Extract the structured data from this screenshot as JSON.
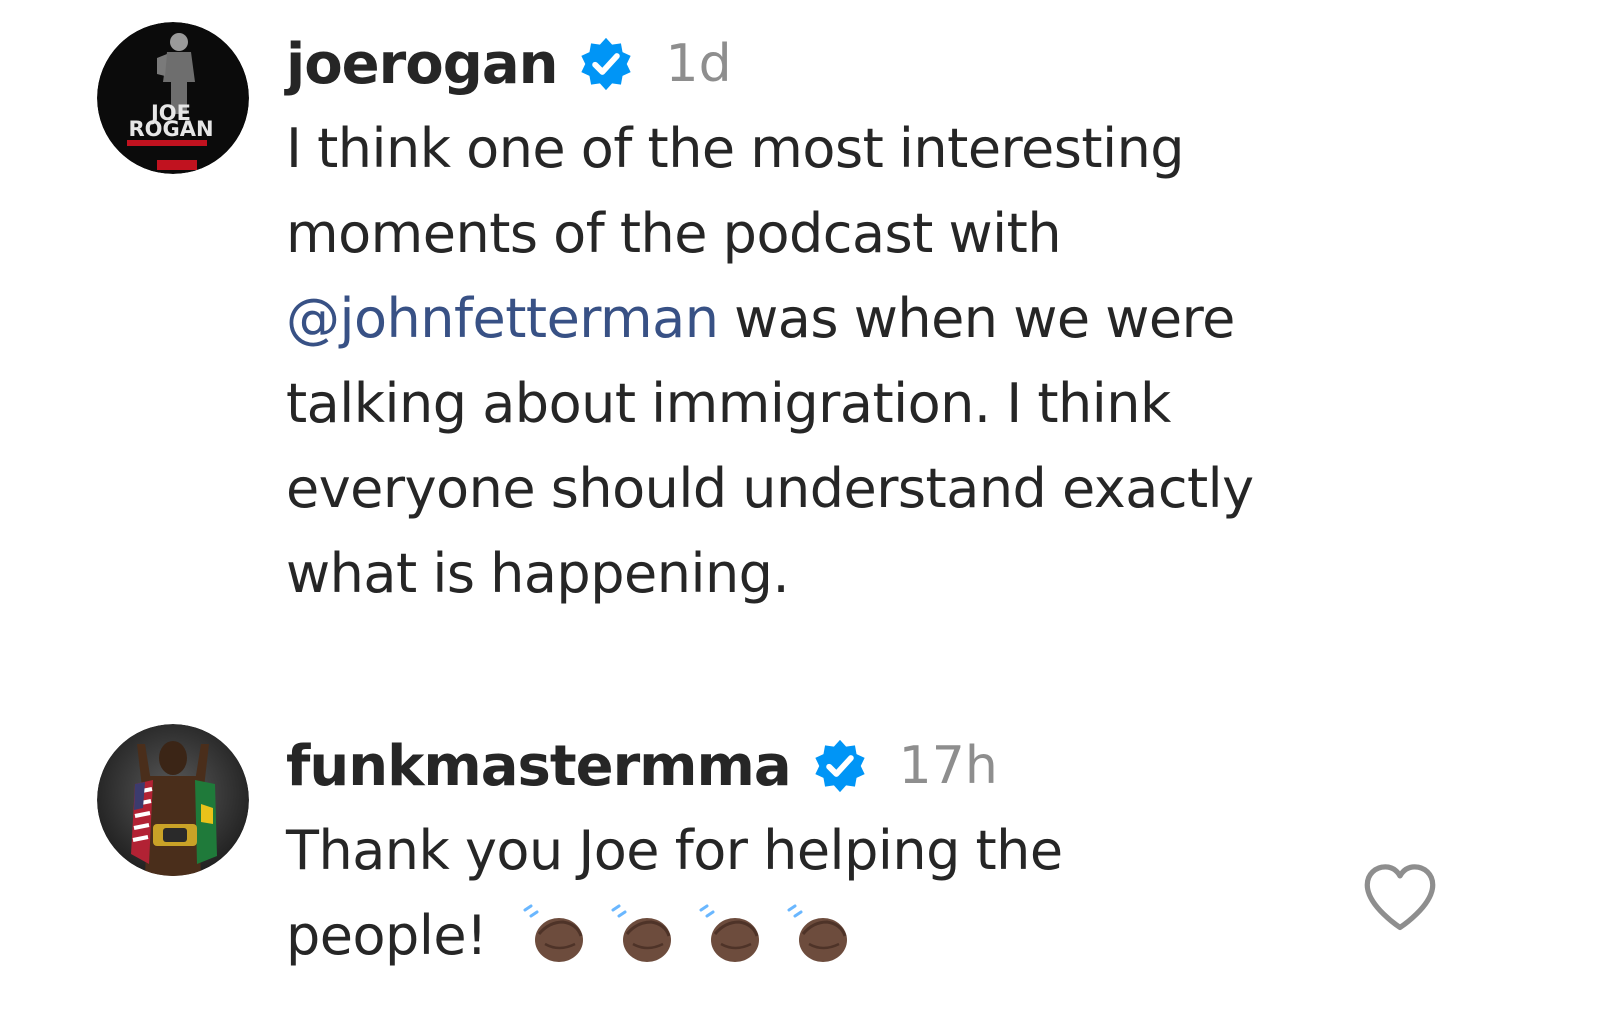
{
  "comments": [
    {
      "username": "joerogan",
      "time": "1d",
      "avatar_text_line1": "JOE",
      "avatar_text_line2": "ROGAN",
      "text_before": "I think one of the most interesting moments of the podcast with ",
      "mention": "@johnfetterman",
      "text_after": " was when we were talking about immigration. I think everyone should understand exactly what is happening."
    },
    {
      "username": "funkmastermma",
      "time": "17h",
      "text": "Thank you Joe for helping the people!",
      "emoji_count": 4
    }
  ],
  "icons": {
    "verified": "verified-badge-icon",
    "like": "heart-outline-icon",
    "emoji": "clapping-hands-emoji"
  },
  "colors": {
    "verified_blue": "#0095f6",
    "mention_blue": "#385185",
    "timestamp_gray": "#8e8e8e",
    "text": "#262626"
  }
}
